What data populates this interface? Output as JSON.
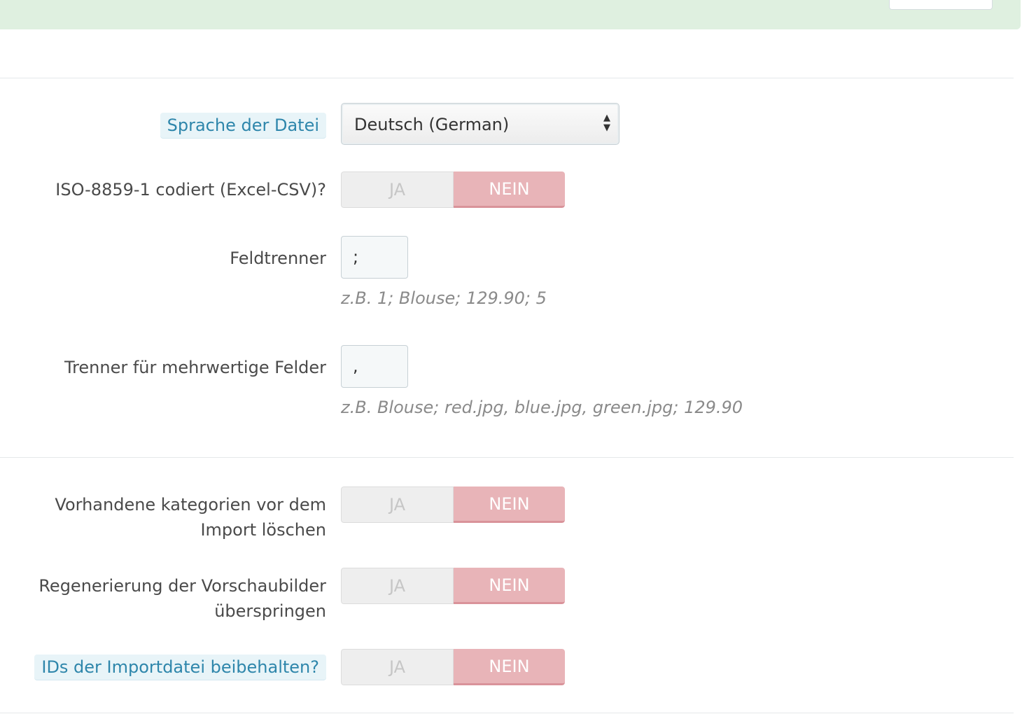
{
  "form": {
    "language": {
      "label": "Sprache der Datei",
      "selected": "Deutsch (German)",
      "arrows": "▲▼"
    },
    "iso_encoding": {
      "label": "ISO-8859-1 codiert (Excel-CSV)?",
      "yes": "JA",
      "no": "NEIN",
      "value": "NEIN"
    },
    "field_separator": {
      "label": "Feldtrenner",
      "value": ";",
      "hint": "z.B. 1; Blouse; 129.90; 5"
    },
    "multi_value_separator": {
      "label": "Trenner für mehrwertige Felder",
      "value": ",",
      "hint": "z.B. Blouse; red.jpg, blue.jpg, green.jpg; 129.90"
    },
    "delete_categories": {
      "label_line1": "Vorhandene kategorien vor dem",
      "label_line2": "Import löschen",
      "yes": "JA",
      "no": "NEIN",
      "value": "NEIN"
    },
    "skip_thumbnails": {
      "label_line1": "Regenerierung der Vorschaubilder",
      "label_line2": "überspringen",
      "yes": "JA",
      "no": "NEIN",
      "value": "NEIN"
    },
    "keep_ids": {
      "label": "IDs der Importdatei beibehalten?",
      "yes": "JA",
      "no": "NEIN",
      "value": "NEIN"
    }
  }
}
